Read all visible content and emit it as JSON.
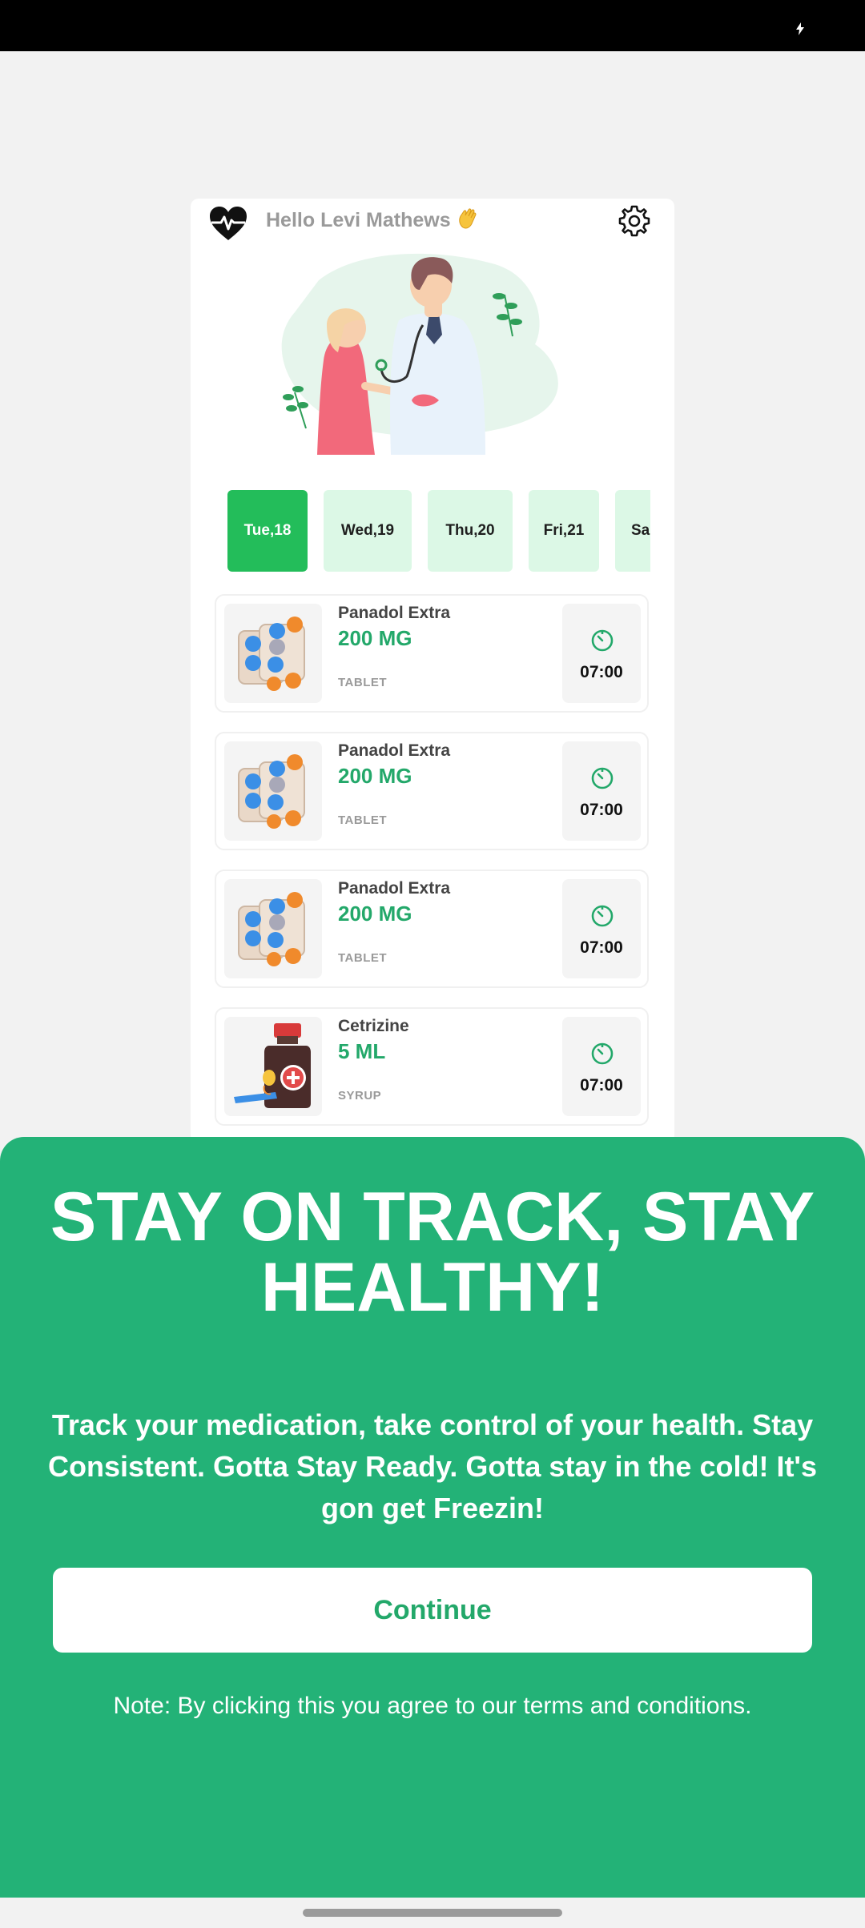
{
  "status_bar": {
    "icons": [
      "charging-bolt-icon"
    ]
  },
  "header": {
    "greeting": "Hello Levi Mathews",
    "greeting_emoji": "waving-hand-icon",
    "logo_icon": "heart-pulse-icon",
    "settings_icon": "gear-icon"
  },
  "hero": {
    "illustration": "doctor-and-patient-illustration"
  },
  "days": [
    {
      "label": "Tue,18",
      "active": true
    },
    {
      "label": "Wed,19",
      "active": false
    },
    {
      "label": "Thu,20",
      "active": false
    },
    {
      "label": "Fri,21",
      "active": false
    },
    {
      "label": "Sa",
      "active": false
    }
  ],
  "medications": [
    {
      "name": "Panadol Extra",
      "dose": "200 MG",
      "form": "TABLET",
      "time": "07:00",
      "icon": "pill-blister-icon"
    },
    {
      "name": "Panadol Extra",
      "dose": "200 MG",
      "form": "TABLET",
      "time": "07:00",
      "icon": "pill-blister-icon"
    },
    {
      "name": "Panadol Extra",
      "dose": "200 MG",
      "form": "TABLET",
      "time": "07:00",
      "icon": "pill-blister-icon"
    },
    {
      "name": "Cetrizine",
      "dose": "5 ML",
      "form": "SYRUP",
      "time": "07:00",
      "icon": "syrup-bottle-icon"
    }
  ],
  "sheet": {
    "title": "STAY ON TRACK, STAY HEALTHY!",
    "body": "Track your medication, take control of your health. Stay Consistent. Gotta Stay Ready. Gotta stay in the cold! It's gon get Freezin!",
    "continue_label": "Continue",
    "note": "Note: By clicking this you agree to our terms and conditions."
  },
  "colors": {
    "primary_green": "#23b277",
    "active_day": "#23bd5a",
    "day_chip": "#dcf8e6",
    "dose_text": "#23a86a"
  }
}
